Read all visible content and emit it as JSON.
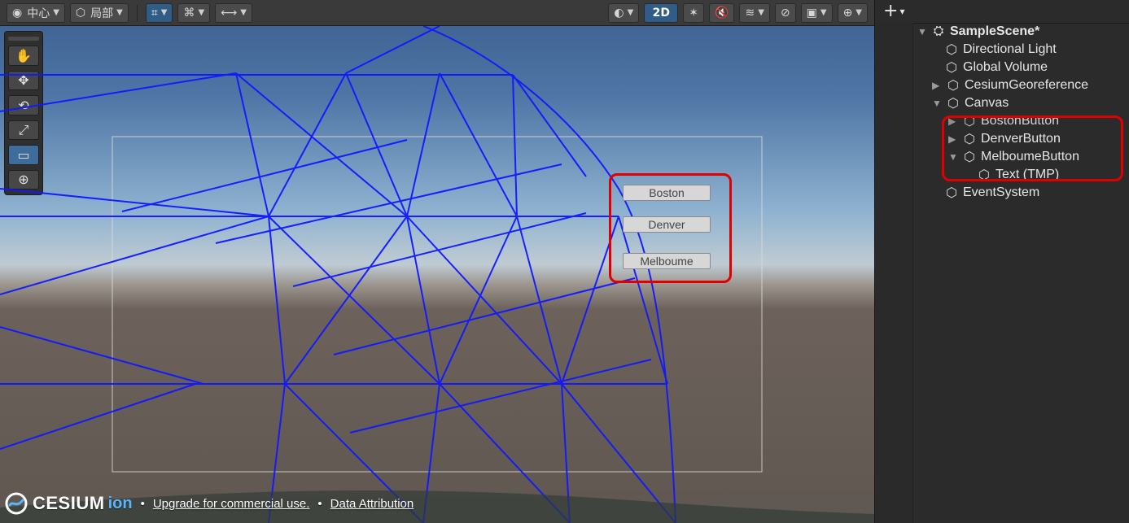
{
  "toolbar": {
    "pivot_label": "中心",
    "space_label": "局部",
    "mode_2d_label": "2D"
  },
  "scene": {
    "buttons": [
      "Boston",
      "Denver",
      "Melboume"
    ],
    "footer": {
      "brand": "CESIUM",
      "brand_suffix": "ion",
      "bullet": "•",
      "upgrade_text": "Upgrade for commercial use.",
      "attribution_text": "Data Attribution"
    }
  },
  "hierarchy": {
    "add_label": "+",
    "add_dropdown": "▾",
    "scene_name": "SampleScene*",
    "items": [
      {
        "label": "Directional Light"
      },
      {
        "label": "Global Volume"
      },
      {
        "label": "CesiumGeoreference"
      },
      {
        "label": "Canvas"
      },
      {
        "label": "BostonButton"
      },
      {
        "label": "DenverButton"
      },
      {
        "label": "MelboumeButton"
      },
      {
        "label": "Text (TMP)"
      },
      {
        "label": "EventSystem"
      }
    ]
  },
  "colors": {
    "highlight": "#e00000",
    "wireframe": "#1018ff",
    "panel_bg": "#2b2b2b"
  },
  "icons": {
    "tools": [
      "hand-icon",
      "move-icon",
      "rotate-icon",
      "scale-icon",
      "rect-icon",
      "transform-icon"
    ],
    "hierarchy_object": "cube-icon",
    "scene": "unity-scene-icon"
  }
}
